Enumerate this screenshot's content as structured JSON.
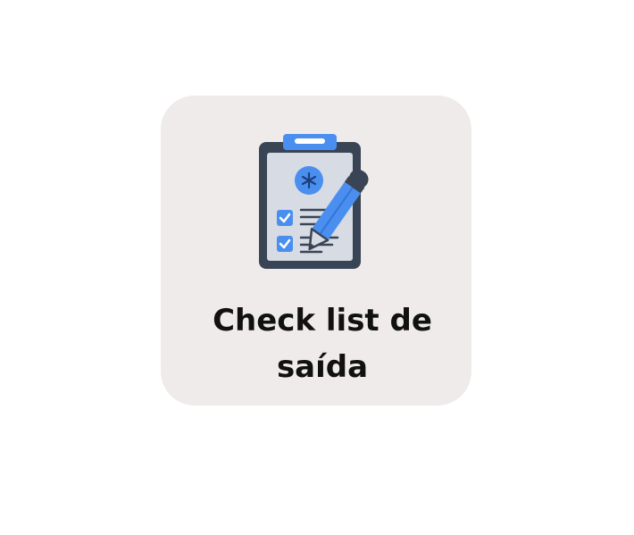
{
  "tile": {
    "label_line1": "Check list de",
    "label_line2": "saída",
    "icon": "clipboard-checklist-pencil-icon",
    "background_color": "#efebeb"
  },
  "colors": {
    "accent": "#4a8ff0",
    "outline": "#394454",
    "paper": "#d6dbe4"
  }
}
